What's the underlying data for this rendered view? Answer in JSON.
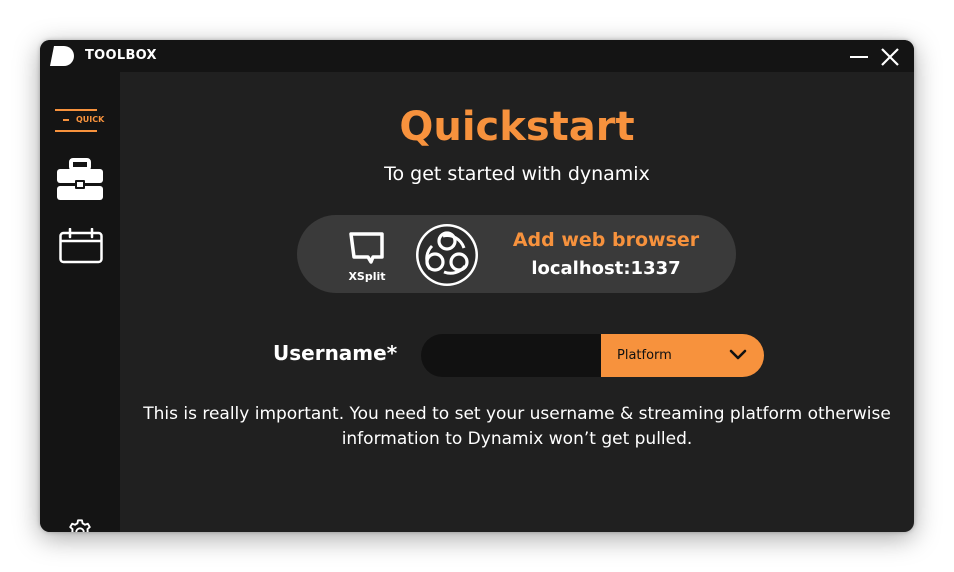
{
  "app": {
    "title": "TOOLBOX"
  },
  "sidebar": {
    "items": [
      {
        "label": "QUICK",
        "icon": "quickstart-icon",
        "active": true
      },
      {
        "icon": "toolbox-icon"
      },
      {
        "icon": "calendar-icon"
      },
      {
        "icon": "gear-icon"
      }
    ]
  },
  "main": {
    "title": "Quickstart",
    "subtitle": "To get started with dynamix",
    "browser_source": {
      "xsplit_label": "XSplit",
      "add_label": "Add web browser",
      "url": "localhost:1337"
    },
    "username": {
      "label": "Username*",
      "value": "",
      "placeholder": ""
    },
    "platform": {
      "selected": "Platform"
    },
    "notice": "This is really important. You need to set your username & streaming platform otherwise information to Dynamix won’t get pulled."
  },
  "colors": {
    "accent": "#f7923d",
    "background": "#202020",
    "sidebar": "#141414",
    "pill": "#3a3a3a"
  }
}
